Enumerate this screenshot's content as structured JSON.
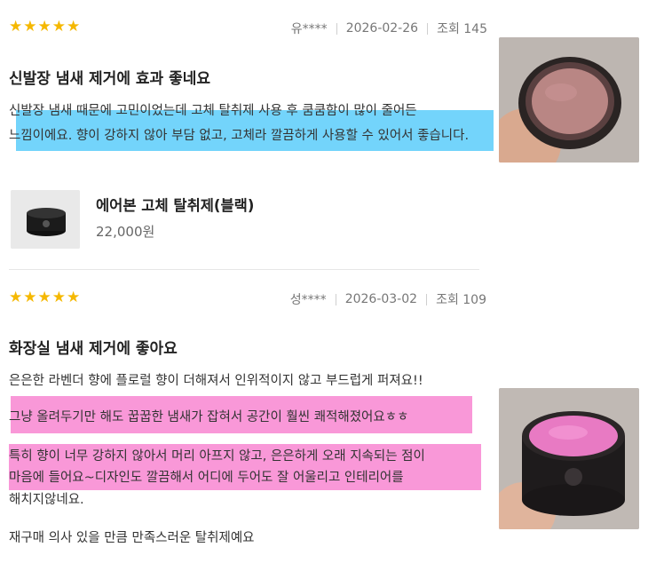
{
  "reviews": [
    {
      "rating": 5,
      "author": "유****",
      "date": "2026-02-26",
      "views": "조회 145",
      "title": "신발장 냄새 제거에 효과 좋네요",
      "lines": [
        "신발장 냄새 때문에 고민이었는데 고체 탈취제 사용 후 쿰쿰함이 많이 줄어든",
        "느낌이에요. 향이 강하지 않아 부담 없고, 고체라 깔끔하게 사용할 수 있어서 좋습니다."
      ],
      "photo_icon": "jar-photo-rose"
    },
    {
      "rating": 5,
      "author": "성****",
      "date": "2026-03-02",
      "views": "조회 109",
      "title": "화장실 냄새 제거에 좋아요",
      "lines": [
        "은은한 라벤더 향에 플로럴 향이 더해져서 인위적이지 않고 부드럽게 퍼져요!!",
        "그냥 올려두기만 해도 꿉꿉한 냄새가 잡혀서 공간이 훨씬 쾌적해졌어요ㅎㅎ",
        "특히 향이 너무 강하지 않아서 머리 아프지 않고, 은은하게 오래 지속되는 점이",
        "마음에 들어요~디자인도 깔끔해서 어디에 두어도 잘 어울리고 인테리어를",
        "해치지않네요.",
        "재구매 의사 있을 만큼 만족스러운 탈취제예요"
      ],
      "photo_icon": "jar-photo-pink"
    }
  ],
  "product": {
    "name": "에어본 고체 탈취제(블랙)",
    "price": "22,000원",
    "thumb_icon": "black-jar-thumbnail"
  },
  "colors": {
    "star": "#f5b800",
    "highlight_blue": "#5acdfa",
    "highlight_pink": "#f776cb"
  }
}
